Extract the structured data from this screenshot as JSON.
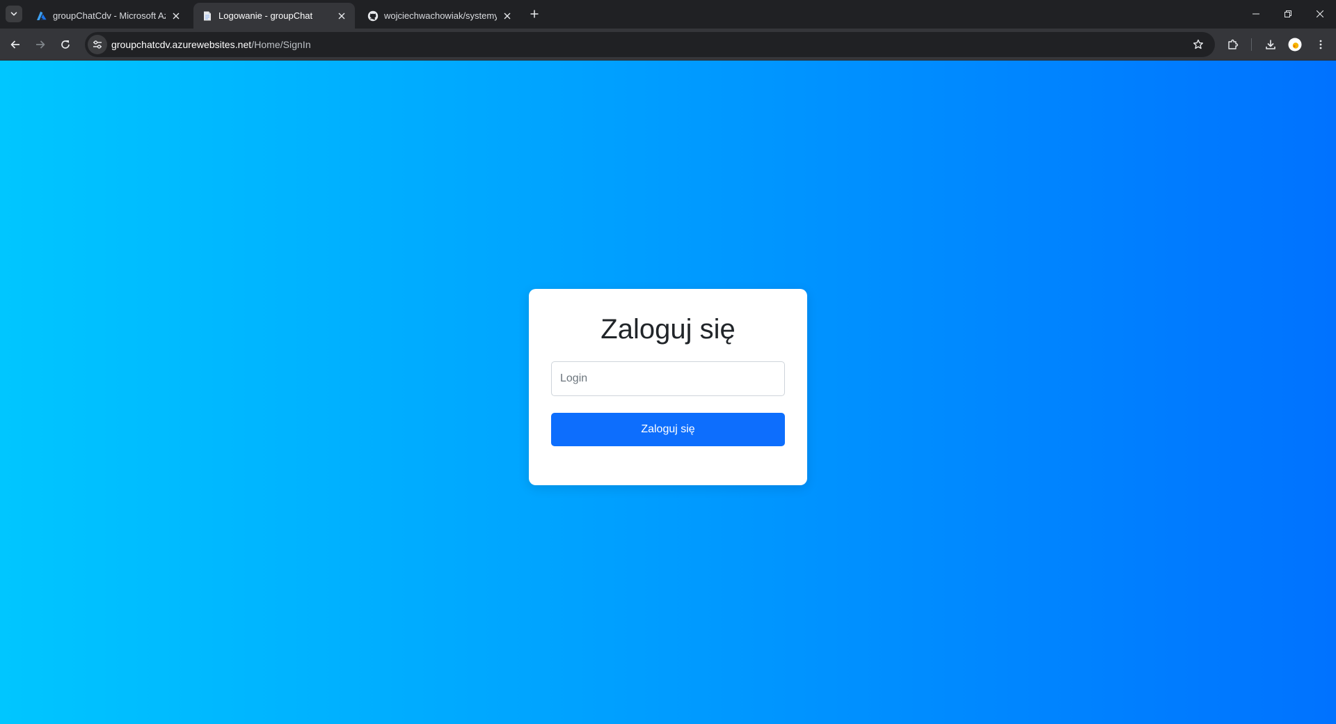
{
  "browser": {
    "tabs": [
      {
        "title": "groupChatCdv - Microsoft Azure",
        "favicon": "azure-icon",
        "active": false
      },
      {
        "title": "Logowanie - groupChat",
        "favicon": "document-icon",
        "active": true
      },
      {
        "title": "wojciechwachowiak/systemy",
        "favicon": "github-icon",
        "active": false
      }
    ],
    "url": {
      "host": "groupchatcdv.azurewebsites.net",
      "path": "/Home/SignIn"
    }
  },
  "colors": {
    "gradient_start": "#00c6ff",
    "gradient_end": "#0072ff",
    "button": "#0d6efd"
  },
  "login": {
    "heading": "Zaloguj się",
    "login_placeholder": "Login",
    "login_value": "",
    "submit_label": "Zaloguj się"
  }
}
